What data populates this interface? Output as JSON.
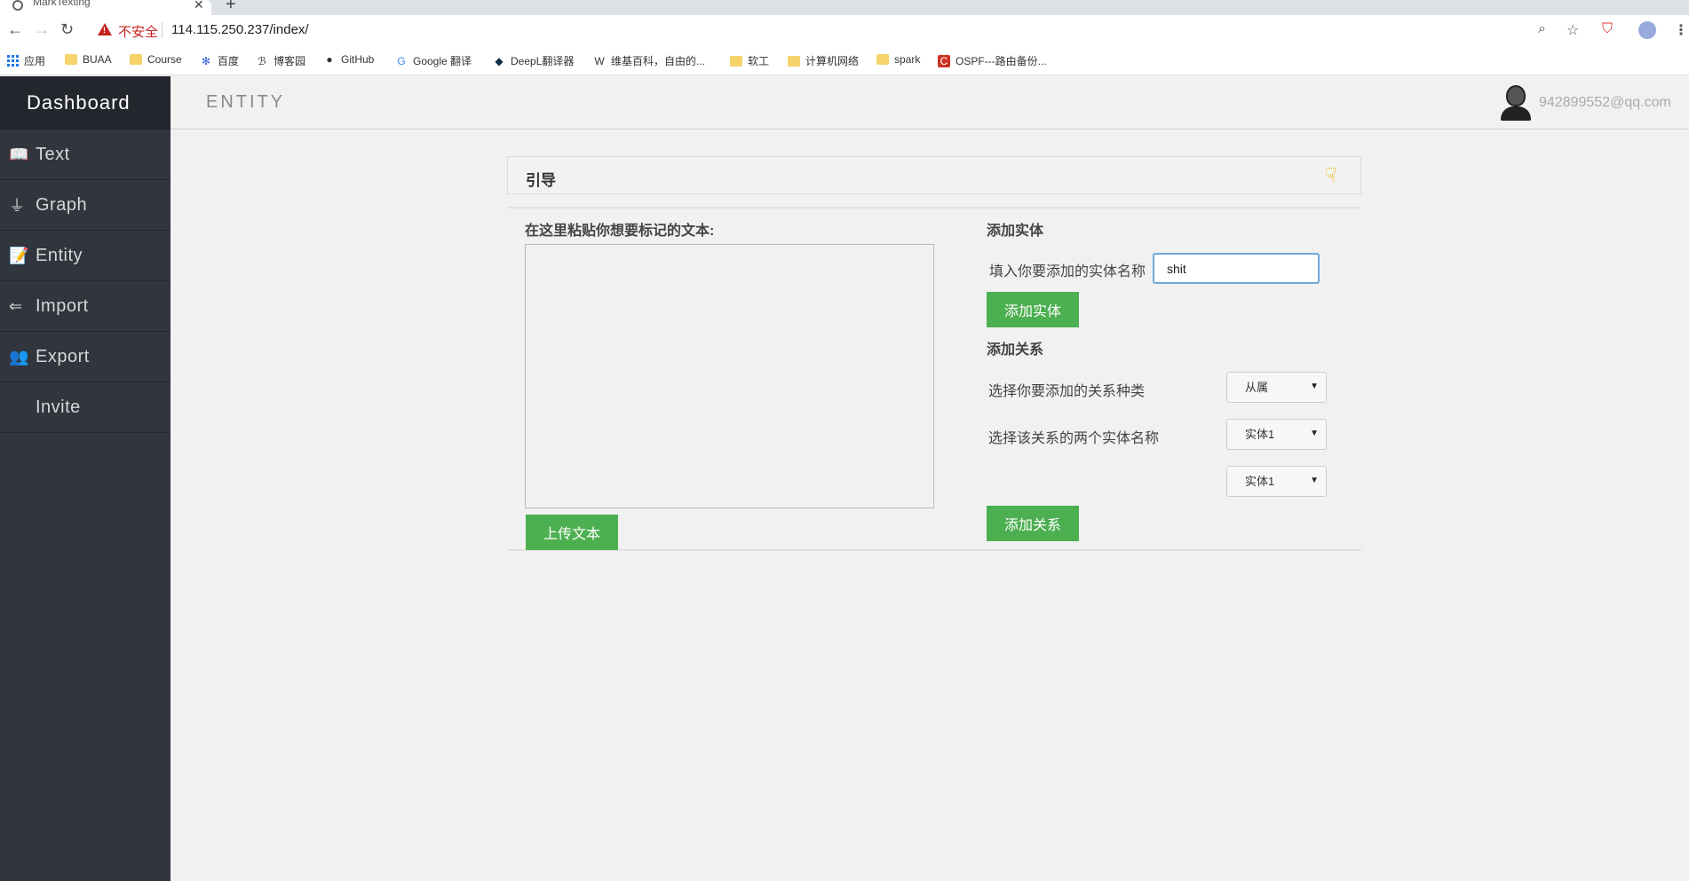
{
  "browser": {
    "tab_title": "MarkTexting",
    "security_label": "不安全",
    "url": "114.115.250.237/index/"
  },
  "bookmarks": [
    {
      "label": "应用",
      "icon": "apps-grid-icon"
    },
    {
      "label": "BUAA",
      "icon": "folder-icon"
    },
    {
      "label": "Course",
      "icon": "folder-icon"
    },
    {
      "label": "百度",
      "icon": "baidu-icon"
    },
    {
      "label": "博客园",
      "icon": "cnblogs-icon"
    },
    {
      "label": "GitHub",
      "icon": "github-icon"
    },
    {
      "label": "Google 翻译",
      "icon": "google-translate-icon"
    },
    {
      "label": "DeepL翻译器",
      "icon": "deepl-icon"
    },
    {
      "label": "维基百科，自由的...",
      "icon": "wikipedia-icon"
    },
    {
      "label": "软工",
      "icon": "folder-icon"
    },
    {
      "label": "计算机网络",
      "icon": "folder-icon"
    },
    {
      "label": "spark",
      "icon": "folder-icon"
    },
    {
      "label": "OSPF---路由备份...",
      "icon": "csdn-icon"
    }
  ],
  "sidebar": {
    "brand": "Dashboard",
    "items": [
      {
        "label": "Text",
        "icon": "book-icon"
      },
      {
        "label": "Graph",
        "icon": "graph-icon"
      },
      {
        "label": "Entity",
        "icon": "notepad-icon"
      },
      {
        "label": "Import",
        "icon": "arrow-left-icon"
      },
      {
        "label": "Export",
        "icon": "users-icon"
      },
      {
        "label": "Invite",
        "icon": ""
      }
    ]
  },
  "header": {
    "page_title": "ENTITY",
    "user_email": "942899552@qq.com"
  },
  "panel": {
    "title": "引导",
    "paste_label": "在这里粘贴你想要标记的文本:",
    "upload_button": "上传文本",
    "add_entity_section": "添加实体",
    "entity_name_label": "填入你要添加的实体名称",
    "entity_name_value": "shit",
    "add_entity_button": "添加实体",
    "add_relation_section": "添加关系",
    "relation_type_label": "选择你要添加的关系种类",
    "relation_type_value": "从属",
    "relation_entities_label": "选择该关系的两个实体名称",
    "entity1_value": "实体1",
    "entity2_value": "实体1",
    "add_relation_button": "添加关系"
  }
}
